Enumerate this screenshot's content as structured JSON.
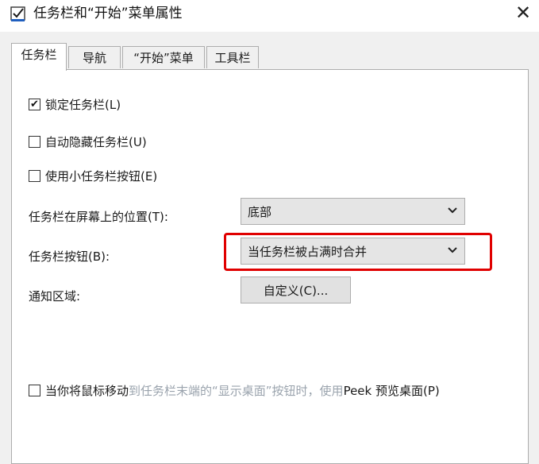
{
  "window": {
    "title": "任务栏和“开始”菜单属性",
    "close_glyph": "✕",
    "icon": "taskbar-properties-icon"
  },
  "tabs": [
    {
      "label": "任务栏",
      "active": true
    },
    {
      "label": "导航",
      "active": false
    },
    {
      "label": "“开始”菜单",
      "active": false
    },
    {
      "label": "工具栏",
      "active": false
    }
  ],
  "options": {
    "lock_taskbar": {
      "label": "锁定任务栏(L)",
      "checked": true
    },
    "auto_hide": {
      "label": "自动隐藏任务栏(U)",
      "checked": false
    },
    "small_buttons": {
      "label": "使用小任务栏按钮(E)",
      "checked": false
    }
  },
  "position": {
    "label": "任务栏在屏幕上的位置(T):",
    "value": "底部"
  },
  "buttons": {
    "label": "任务栏按钮(B):",
    "value": "当任务栏被占满时合并"
  },
  "notification": {
    "label": "通知区域:",
    "button_label": "自定义(C)..."
  },
  "peek": {
    "label_prefix": "当你将鼠标移动",
    "label_obscured": "到任务栏末端的“显示桌面”按钮时，使用",
    "label_suffix": "Peek 预览桌面(P)",
    "checked": false
  },
  "colors": {
    "highlight": "#e00000",
    "panel": "#ffffff",
    "dialog": "#f0f0f0"
  }
}
